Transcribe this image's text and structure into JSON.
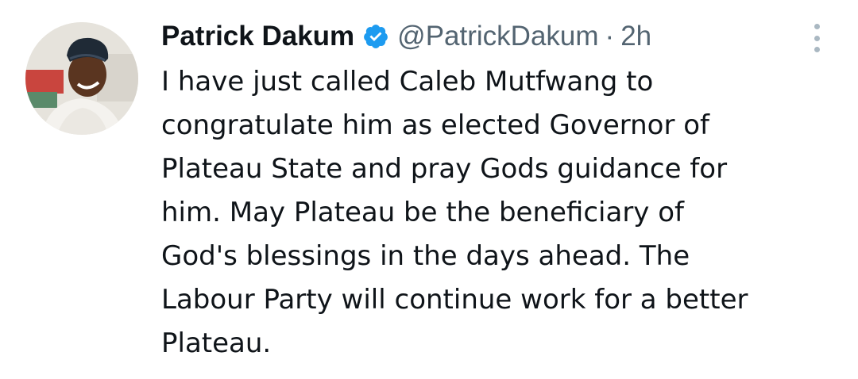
{
  "tweet": {
    "author": {
      "display_name": "Patrick Dakum",
      "handle": "@PatrickDakum",
      "verified_icon": "verified-badge-icon",
      "avatar": "profile-photo"
    },
    "separator": "·",
    "timestamp": "2h",
    "more_icon": "more-options-icon",
    "text": "I have just called Caleb Mutfwang to\ncongratulate him as elected Governor of\nPlateau State and pray Gods guidance for\nhim. May Plateau be the beneficiary of\nGod's blessings in the days ahead. The\nLabour Party will continue work for a better\nPlateau."
  },
  "colors": {
    "text_primary": "#0f1419",
    "text_secondary": "#536471",
    "verified_blue": "#1d9bf0",
    "background": "#ffffff"
  }
}
